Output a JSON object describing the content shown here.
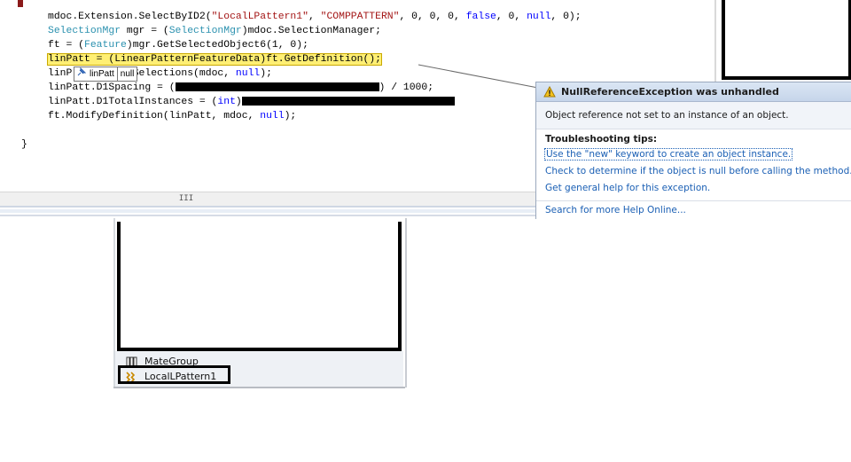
{
  "editor": {
    "lines": [
      {
        "segments": [
          {
            "t": "mdoc.Extension.SelectByID2(",
            "c": ""
          },
          {
            "t": "\"LocalLPattern1\"",
            "c": "str"
          },
          {
            "t": ", ",
            "c": ""
          },
          {
            "t": "\"COMPPATTERN\"",
            "c": "str"
          },
          {
            "t": ", 0, 0, 0, ",
            "c": ""
          },
          {
            "t": "false",
            "c": "kw"
          },
          {
            "t": ", 0, ",
            "c": ""
          },
          {
            "t": "null",
            "c": "kw"
          },
          {
            "t": ", 0);",
            "c": ""
          }
        ]
      },
      {
        "segments": [
          {
            "t": "SelectionMgr",
            "c": "typ"
          },
          {
            "t": " mgr = (",
            "c": ""
          },
          {
            "t": "SelectionMgr",
            "c": "typ"
          },
          {
            "t": ")mdoc.SelectionManager;",
            "c": ""
          }
        ]
      },
      {
        "segments": [
          {
            "t": "ft = (",
            "c": ""
          },
          {
            "t": "Feature",
            "c": "typ"
          },
          {
            "t": ")mgr.GetSelectedObject6(1, 0);",
            "c": ""
          }
        ]
      },
      {
        "segments": [
          {
            "t": "linPatt = (LinearPatternFeatureData)ft.GetDefinition();",
            "c": "hl"
          }
        ]
      },
      {
        "segments": [
          {
            "t": "linP",
            "c": ""
          },
          {
            "t": "          ",
            "c": ""
          },
          {
            "t": "Selections(mdoc, ",
            "c": ""
          },
          {
            "t": "null",
            "c": "kw"
          },
          {
            "t": ");",
            "c": ""
          }
        ]
      },
      {
        "segments": [
          {
            "t": "linPatt.D1Spacing = (",
            "c": ""
          },
          {
            "t": "#R230",
            "c": "redact"
          },
          {
            "t": ") / 1000;",
            "c": ""
          }
        ]
      },
      {
        "segments": [
          {
            "t": "linPatt.D1TotalInstances = (",
            "c": ""
          },
          {
            "t": "int",
            "c": "kw"
          },
          {
            "t": ")",
            "c": ""
          },
          {
            "t": "#R240",
            "c": "redact"
          }
        ]
      },
      {
        "segments": [
          {
            "t": "ft.ModifyDefinition(linPatt, mdoc, ",
            "c": ""
          },
          {
            "t": "null",
            "c": "kw"
          },
          {
            "t": ");",
            "c": ""
          }
        ]
      },
      {
        "segments": [
          {
            "t": "",
            "c": ""
          }
        ]
      },
      {
        "segments": [
          {
            "t": "}",
            "c": ""
          }
        ]
      }
    ],
    "datatip": {
      "name": "linPatt",
      "value": "null"
    },
    "hscroll_grip": "III"
  },
  "exception": {
    "title": "NullReferenceException was unhandled",
    "message": "Object reference not set to an instance of an object.",
    "tips_title": "Troubleshooting tips:",
    "tips": [
      "Use the \"new\" keyword to create an object instance.",
      "Check to determine if the object is null before calling the method.",
      "Get general help for this exception."
    ],
    "search_link": "Search for more Help Online..."
  },
  "tree": {
    "items": [
      {
        "label": "MateGroup",
        "icon": "mategroup-icon"
      },
      {
        "label": "LocalLPattern1",
        "icon": "linear-pattern-icon"
      }
    ]
  },
  "colors": {
    "highlight": "#ffef74",
    "keyword": "#0000ff",
    "type": "#2b91af",
    "string": "#a31515",
    "link": "#1a5fb4"
  }
}
